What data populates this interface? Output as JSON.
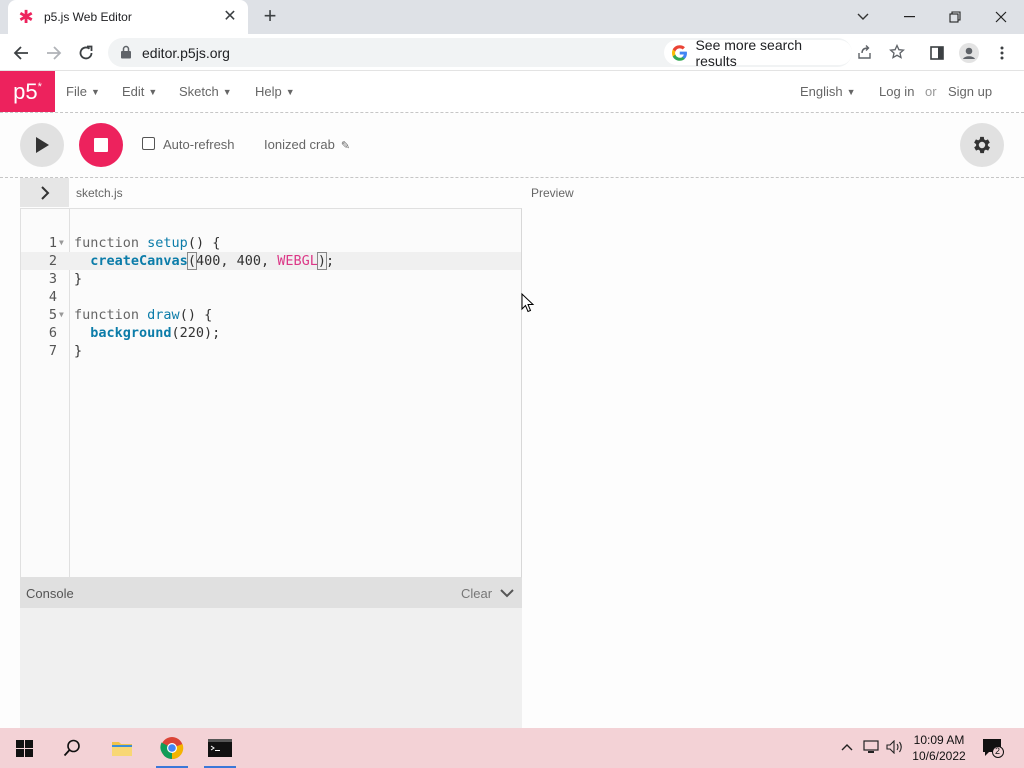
{
  "browser": {
    "tab_title": "p5.js Web Editor",
    "url": "editor.p5js.org",
    "search_chip": "See more search results"
  },
  "nav": {
    "logo": "p5",
    "logo_sup": "*",
    "menus": [
      "File",
      "Edit",
      "Sketch",
      "Help"
    ],
    "language": "English",
    "login": "Log in",
    "or": "or",
    "signup": "Sign up"
  },
  "toolbar": {
    "auto_refresh_label": "Auto-refresh",
    "auto_refresh_checked": false,
    "sketch_name": "Ionized crab"
  },
  "editor": {
    "file_name": "sketch.js",
    "preview_label": "Preview",
    "active_line": 2,
    "lines": [
      {
        "n": "1",
        "foldable": true
      },
      {
        "n": "2",
        "foldable": false
      },
      {
        "n": "3",
        "foldable": false
      },
      {
        "n": "4",
        "foldable": false
      },
      {
        "n": "5",
        "foldable": true
      },
      {
        "n": "6",
        "foldable": false
      },
      {
        "n": "7",
        "foldable": false
      }
    ],
    "code": {
      "l1_kw": "function",
      "l1_fn": "setup",
      "l1_rest": "() {",
      "l2_fn": "createCanvas",
      "l2_open": "(",
      "l2_args": "400, 400, ",
      "l2_const": "WEBGL",
      "l2_close": ")",
      "l2_semi": ";",
      "l3": "}",
      "l5_kw": "function",
      "l5_fn": "draw",
      "l5_rest": "() {",
      "l6_fn": "background",
      "l6_rest": "(220);",
      "l7": "}"
    }
  },
  "console": {
    "title": "Console",
    "clear": "Clear"
  },
  "taskbar": {
    "time": "10:09 AM",
    "date": "10/6/2022",
    "notifications": "2"
  },
  "colors": {
    "p5_pink": "#ed225d",
    "taskbar": "#f3d2d6",
    "code_function": "#0b7ca9",
    "code_constant": "#dc3787"
  }
}
